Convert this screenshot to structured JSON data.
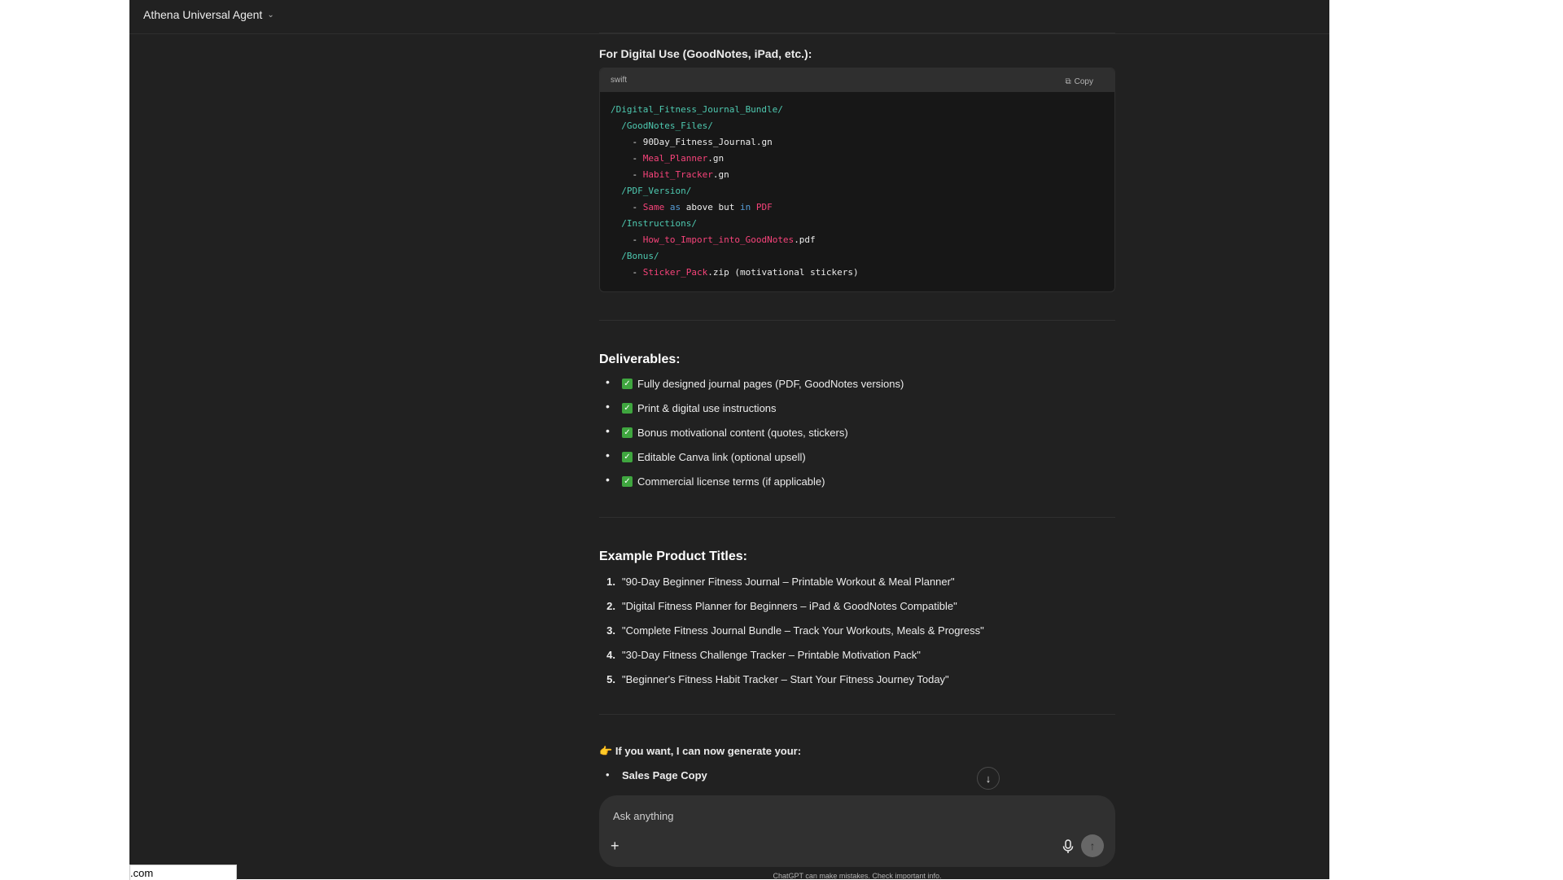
{
  "header": {
    "agent_name": "Athena Universal Agent"
  },
  "digital_use": {
    "heading": "For Digital Use (GoodNotes, iPad, etc.):",
    "code_language": "swift",
    "copy_label": "Copy"
  },
  "code_lines": [
    [
      [
        "/Digital_Fitness_Journal_Bundle/",
        "green"
      ]
    ],
    [
      [
        "  /GoodNotes_Files/",
        "green"
      ]
    ],
    [
      [
        "    - ",
        "white"
      ],
      [
        "90Day_Fitness_Journal.gn",
        "white"
      ]
    ],
    [
      [
        "    - ",
        "white"
      ],
      [
        "Meal_Planner",
        "red"
      ],
      [
        ".gn",
        "white"
      ]
    ],
    [
      [
        "    - ",
        "white"
      ],
      [
        "Habit_Tracker",
        "red"
      ],
      [
        ".gn",
        "white"
      ]
    ],
    [
      [
        "  /PDF_Version/",
        "green"
      ]
    ],
    [
      [
        "    - ",
        "white"
      ],
      [
        "Same",
        "red"
      ],
      [
        " ",
        "white"
      ],
      [
        "as",
        "blue"
      ],
      [
        " above but ",
        "white"
      ],
      [
        "in",
        "blue"
      ],
      [
        " ",
        "white"
      ],
      [
        "PDF",
        "red"
      ]
    ],
    [
      [
        "  /Instructions/",
        "green"
      ]
    ],
    [
      [
        "    - ",
        "white"
      ],
      [
        "How_to_Import_into_GoodNotes",
        "red"
      ],
      [
        ".pdf",
        "white"
      ]
    ],
    [
      [
        "  /Bonus/",
        "green"
      ]
    ],
    [
      [
        "    - ",
        "white"
      ],
      [
        "Sticker_Pack",
        "red"
      ],
      [
        ".zip (motivational stickers)",
        "white"
      ]
    ]
  ],
  "deliverables": {
    "heading": "Deliverables:",
    "items": [
      "Fully designed journal pages (PDF, GoodNotes versions)",
      "Print & digital use instructions",
      "Bonus motivational content (quotes, stickers)",
      "Editable Canva link (optional upsell)",
      "Commercial license terms (if applicable)"
    ]
  },
  "titles": {
    "heading": "Example Product Titles:",
    "items": [
      "\"90-Day Beginner Fitness Journal – Printable Workout & Meal Planner\"",
      "\"Digital Fitness Planner for Beginners – iPad & GoodNotes Compatible\"",
      "\"Complete Fitness Journal Bundle – Track Your Workouts, Meals & Progress\"",
      "\"30-Day Fitness Challenge Tracker – Printable Motivation Pack\"",
      "\"Beginner's Fitness Habit Tracker – Start Your Fitness Journey Today\""
    ]
  },
  "offer": {
    "emoji": "👉",
    "text": "If you want, I can now generate your:",
    "first_item": "Sales Page Copy"
  },
  "composer": {
    "placeholder": "Ask anything"
  },
  "footer": {
    "disclaimer": "ChatGPT can make mistakes. Check important info."
  },
  "status_bar": {
    "url_fragment": ".com"
  }
}
